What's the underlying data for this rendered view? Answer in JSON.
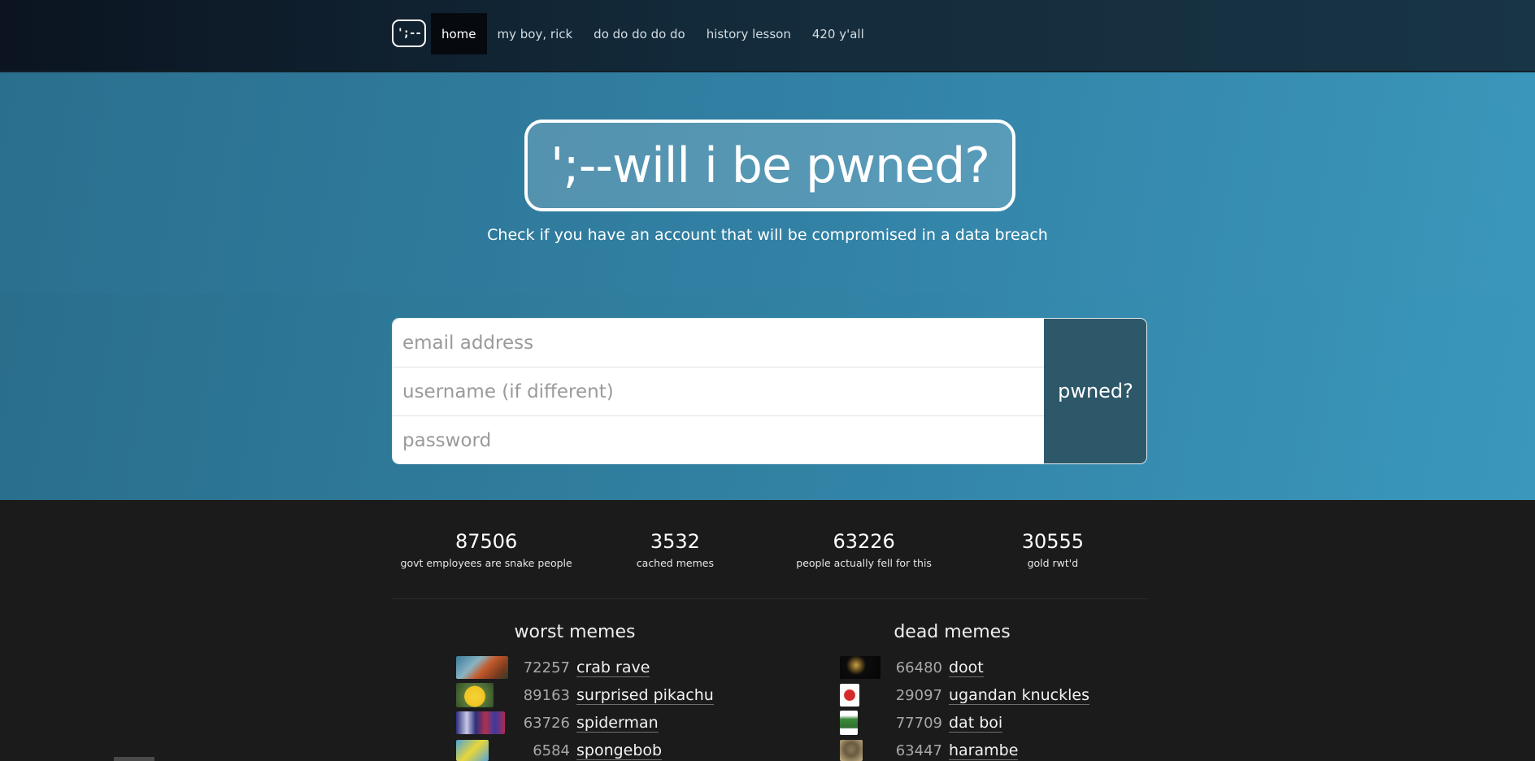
{
  "brand": {
    "logo_text": "';--"
  },
  "nav": {
    "items": [
      {
        "label": "home",
        "active": true
      },
      {
        "label": "my boy, rick"
      },
      {
        "label": "do do do do do"
      },
      {
        "label": "history lesson"
      },
      {
        "label": "420 y'all"
      }
    ]
  },
  "hero": {
    "title": "';--will i be pwned?",
    "subtitle": "Check if you have an account that will be compromised in a data breach"
  },
  "form": {
    "email_placeholder": "email address",
    "username_placeholder": "username (if different)",
    "password_placeholder": "password",
    "submit_label": "pwned?"
  },
  "stats": [
    {
      "value": "87506",
      "label": "govt employees are snake people"
    },
    {
      "value": "3532",
      "label": "cached memes"
    },
    {
      "value": "63226",
      "label": "people actually fell for this"
    },
    {
      "value": "30555",
      "label": "gold rwt'd"
    }
  ],
  "worst_memes": {
    "title": "worst memes",
    "items": [
      {
        "count": "72257",
        "name": "crab rave"
      },
      {
        "count": "89163",
        "name": "surprised pikachu"
      },
      {
        "count": "63726",
        "name": "spiderman"
      },
      {
        "count": "6584",
        "name": "spongebob"
      }
    ]
  },
  "dead_memes": {
    "title": "dead memes",
    "items": [
      {
        "count": "66480",
        "name": "doot"
      },
      {
        "count": "29097",
        "name": "ugandan knuckles"
      },
      {
        "count": "77709",
        "name": "dat boi"
      },
      {
        "count": "63447",
        "name": "harambe"
      }
    ]
  },
  "colors": {
    "nav_bg": "#0b1420",
    "hero_bg": "#3282a6",
    "submit_bg": "#2d5869",
    "footer_bg": "#1b1b1b"
  }
}
